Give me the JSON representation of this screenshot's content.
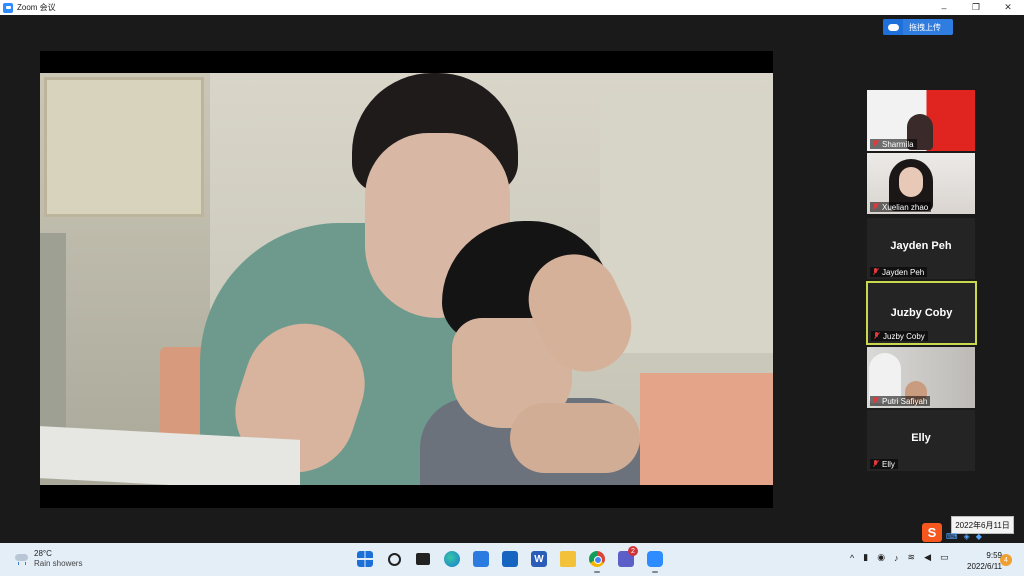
{
  "window": {
    "title": "Zoom 会议",
    "minimize": "–",
    "maximize": "❐",
    "close": "✕"
  },
  "toolbar": {
    "upload_label": "拖拽上传"
  },
  "participants": [
    {
      "tag": "Sharmila",
      "big_name": "",
      "video": "sharmila"
    },
    {
      "tag": "Xuelian zhao",
      "big_name": "",
      "video": "xuelian"
    },
    {
      "tag": "Jayden Peh",
      "big_name": "Jayden Peh",
      "video": ""
    },
    {
      "tag": "Juzby Coby",
      "big_name": "Juzby Coby",
      "video": "",
      "active_speaker": true
    },
    {
      "tag": "Putri Safiyah",
      "big_name": "",
      "video": "putri"
    },
    {
      "tag": "Elly",
      "big_name": "Elly",
      "video": ""
    }
  ],
  "tray_popup": {
    "ime_label": "S",
    "date_tooltip": "2022年6月11日"
  },
  "taskbar": {
    "weather_temp": "28°C",
    "weather_desc": "Rain showers",
    "teams_badge": "2",
    "word_letter": "W",
    "clock_time": "9:59",
    "clock_date": "2022/6/11",
    "notification_count": "4",
    "tray_chevron": "^"
  },
  "colors": {
    "active_speaker_border": "#c9d84c",
    "muted_icon": "#e0393e",
    "upload_button": "#2f7de1",
    "taskbar_bg": "#e4eef7"
  }
}
